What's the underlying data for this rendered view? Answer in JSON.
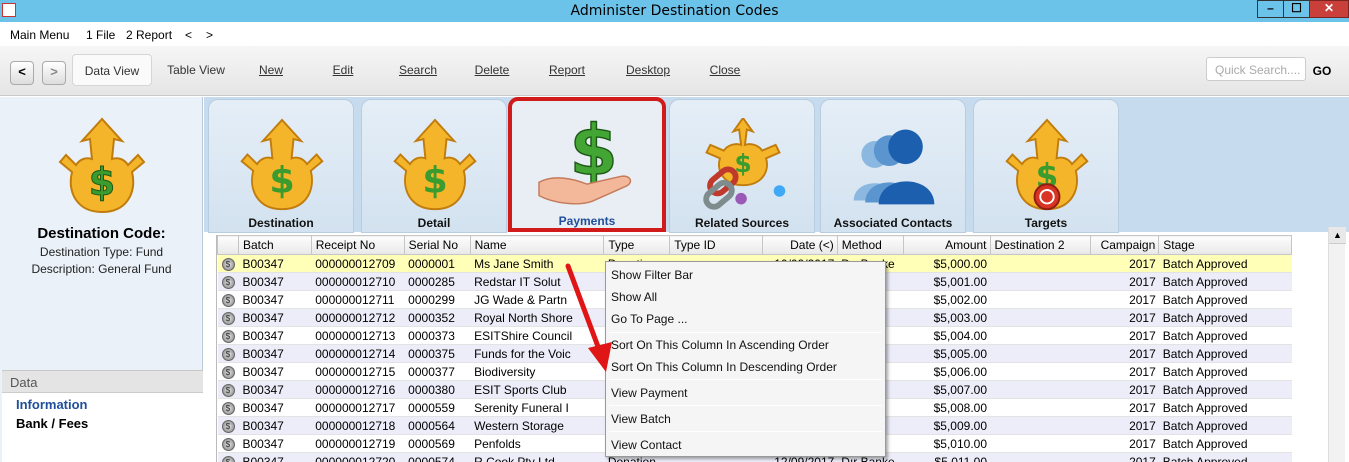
{
  "window": {
    "title": "Administer Destination Codes"
  },
  "menubar": {
    "items": [
      "Main Menu",
      "1 File",
      "2 Report",
      "<",
      ">"
    ]
  },
  "toolbar": {
    "back": "<",
    "forward": ">",
    "data_view": "Data View",
    "table_view": "Table View",
    "new": "New",
    "edit": "Edit",
    "search": "Search",
    "delete": "Delete",
    "report": "Report",
    "desktop": "Desktop",
    "close": "Close",
    "quick_search_placeholder": "Quick Search....",
    "go": "GO"
  },
  "left_panel": {
    "title": "Destination Code:",
    "type_line": "Destination Type: Fund",
    "desc_line": "Description: General Fund",
    "data_header": "Data",
    "items": [
      "Information",
      "Bank / Fees"
    ]
  },
  "tabs": [
    "Destination",
    "Detail",
    "Payments",
    "Related Sources",
    "Associated Contacts",
    "Targets"
  ],
  "grid": {
    "columns": [
      "",
      "Batch",
      "Receipt No",
      "Serial No",
      "Name",
      "Type",
      "Type ID",
      "Date (<)",
      "Method",
      "Amount",
      "Destination 2",
      "Campaign",
      "Stage"
    ],
    "rows": [
      [
        "B00347",
        "000000012709",
        "0000001",
        "Ms Jane Smith",
        "Donation",
        "",
        "10/09/2017",
        "Dır Banke",
        "$5,000.00",
        "",
        "2017",
        "Batch Approved"
      ],
      [
        "B00347",
        "000000012710",
        "0000285",
        "Redstar IT Solut",
        "",
        "",
        "",
        "ke",
        "$5,001.00",
        "",
        "2017",
        "Batch Approved"
      ],
      [
        "B00347",
        "000000012711",
        "0000299",
        "JG Wade & Partn",
        "",
        "",
        "",
        "ke",
        "$5,002.00",
        "",
        "2017",
        "Batch Approved"
      ],
      [
        "B00347",
        "000000012712",
        "0000352",
        "Royal North Shore",
        "",
        "",
        "",
        "ke",
        "$5,003.00",
        "",
        "2017",
        "Batch Approved"
      ],
      [
        "B00347",
        "000000012713",
        "0000373",
        "ESITShire Council",
        "",
        "",
        "",
        "ke",
        "$5,004.00",
        "",
        "2017",
        "Batch Approved"
      ],
      [
        "B00347",
        "000000012714",
        "0000375",
        "Funds for the Voic",
        "",
        "",
        "",
        "ke",
        "$5,005.00",
        "",
        "2017",
        "Batch Approved"
      ],
      [
        "B00347",
        "000000012715",
        "0000377",
        "Biodiversity",
        "",
        "",
        "",
        "ke",
        "$5,006.00",
        "",
        "2017",
        "Batch Approved"
      ],
      [
        "B00347",
        "000000012716",
        "0000380",
        "ESIT Sports Club",
        "",
        "",
        "",
        "ke",
        "$5,007.00",
        "",
        "2017",
        "Batch Approved"
      ],
      [
        "B00347",
        "000000012717",
        "0000559",
        "Serenity Funeral I",
        "",
        "",
        "",
        "ke",
        "$5,008.00",
        "",
        "2017",
        "Batch Approved"
      ],
      [
        "B00347",
        "000000012718",
        "0000564",
        "Western Storage",
        "",
        "",
        "",
        "ke",
        "$5,009.00",
        "",
        "2017",
        "Batch Approved"
      ],
      [
        "B00347",
        "000000012719",
        "0000569",
        "Penfolds",
        "",
        "",
        "",
        "ke",
        "$5,010.00",
        "",
        "2017",
        "Batch Approved"
      ],
      [
        "B00347",
        "000000012720",
        "0000574",
        "R Cook Pty Ltd",
        "Donation",
        "",
        "12/09/2017",
        "Dır Banke",
        "$5,011.00",
        "",
        "2017",
        "Batch Approved"
      ]
    ]
  },
  "context_menu": {
    "items": [
      "Show Filter Bar",
      "Show All",
      "Go To Page ...",
      "Sort On This Column In Ascending Order",
      "Sort On This Column In Descending Order",
      "View Payment",
      "View Batch",
      "View Contact"
    ]
  },
  "colors": {
    "titlebar": "#6cc3ea",
    "highlight_border": "#d11b1b",
    "row_highlight": "#ffffb8",
    "row_alt": "#ecedf9"
  }
}
